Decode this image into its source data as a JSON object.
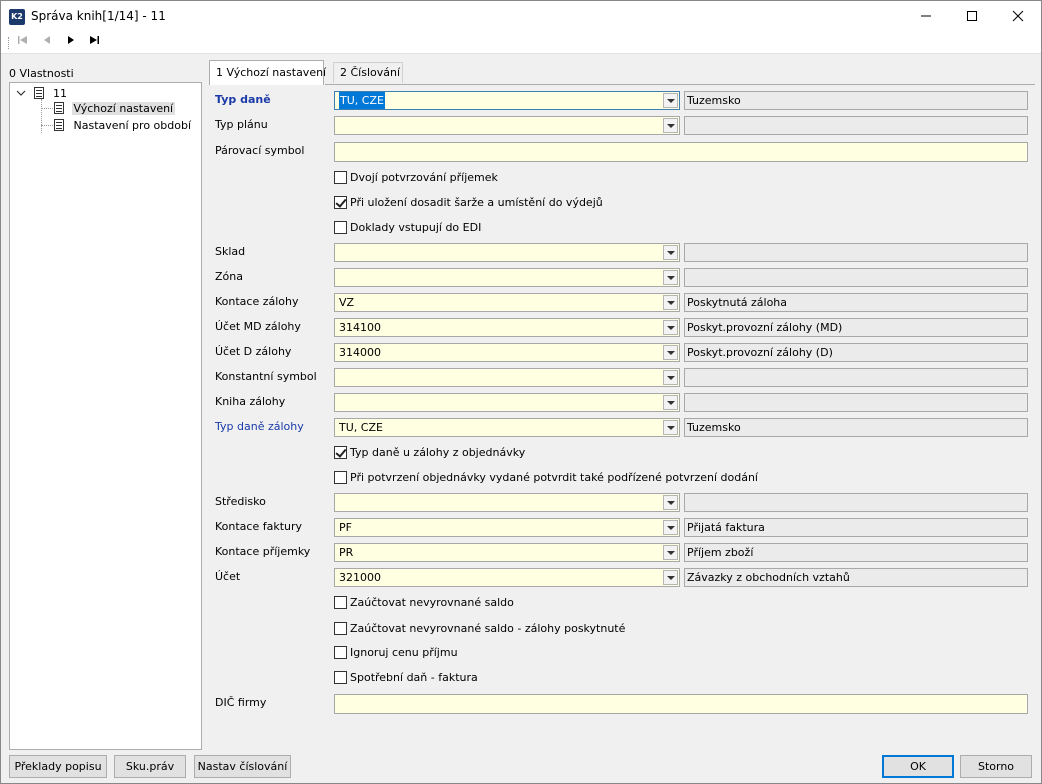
{
  "window": {
    "title": "Správa knih[1/14] - 11",
    "app_icon_text": "K2",
    "controls": [
      "minimize",
      "maximize",
      "close"
    ]
  },
  "toolbar": {
    "buttons": [
      {
        "name": "first-record",
        "enabled": false
      },
      {
        "name": "previous-record",
        "enabled": false
      },
      {
        "name": "next-record",
        "enabled": true
      },
      {
        "name": "last-record",
        "enabled": true
      }
    ]
  },
  "left_panel": {
    "title": "0 Vlastnosti",
    "tree": {
      "root": "11",
      "children": [
        "Výchozí nastavení",
        "Nastavení pro období"
      ],
      "selected": "Výchozí nastavení"
    }
  },
  "tabs": [
    {
      "label": "1 Výchozí nastavení",
      "active": true
    },
    {
      "label": "2 Číslování",
      "active": false
    }
  ],
  "form": {
    "typ_dane": {
      "label": "Typ daně",
      "value": "TU, CZE",
      "description": "Tuzemsko"
    },
    "typ_planu": {
      "label": "Typ plánu",
      "value": "",
      "description": ""
    },
    "parovaci_symbol": {
      "label": "Párovací symbol",
      "value": ""
    },
    "dvoji_potvrzovani": {
      "label": "Dvojí potvrzování příjemek",
      "checked": false
    },
    "pri_ulozeni": {
      "label": "Při uložení dosadit šarže a umístění do výdejů",
      "checked": true
    },
    "doklady_edi": {
      "label": "Doklady vstupují do EDI",
      "checked": false
    },
    "sklad": {
      "label": "Sklad",
      "value": "",
      "description": ""
    },
    "zona": {
      "label": "Zóna",
      "value": "",
      "description": ""
    },
    "kontace_zalohy": {
      "label": "Kontace zálohy",
      "value": "VZ",
      "description": "Poskytnutá záloha"
    },
    "ucet_md_zalohy": {
      "label": "Účet MD zálohy",
      "value": "314100",
      "description": "Poskyt.provozní zálohy (MD)"
    },
    "ucet_d_zalohy": {
      "label": "Účet D zálohy",
      "value": "314000",
      "description": "Poskyt.provozní zálohy (D)"
    },
    "konstantni_symbol": {
      "label": "Konstantní symbol",
      "value": "",
      "description": ""
    },
    "kniha_zalohy": {
      "label": "Kniha zálohy",
      "value": "",
      "description": ""
    },
    "typ_dane_zalohy": {
      "label": "Typ daně zálohy",
      "value": "TU, CZE",
      "description": "Tuzemsko"
    },
    "typ_dane_u_zalohy": {
      "label": "Typ daně u zálohy z objednávky",
      "checked": true
    },
    "pri_potvrzeni": {
      "label": "Při potvrzení objednávky vydané potvrdit také podřízené potvrzení dodání",
      "checked": false
    },
    "stredisko": {
      "label": "Středisko",
      "value": "",
      "description": ""
    },
    "kontace_faktury": {
      "label": "Kontace faktury",
      "value": "PF",
      "description": "Přijatá faktura"
    },
    "kontace_prijemky": {
      "label": "Kontace příjemky",
      "value": "PR",
      "description": "Příjem zboží"
    },
    "ucet": {
      "label": "Účet",
      "value": "321000",
      "description": "Závazky z obchodních vztahů"
    },
    "zauctovat_saldo": {
      "label": "Zaúčtovat nevyrovnané saldo",
      "checked": false
    },
    "zauctovat_saldo_zalohy": {
      "label": "Zaúčtovat nevyrovnané saldo - zálohy poskytnuté",
      "checked": false
    },
    "ignoruj_cenu": {
      "label": "Ignoruj cenu příjmu",
      "checked": false
    },
    "spotrebni_dan": {
      "label": "Spotřební daň - faktura",
      "checked": false
    },
    "dic_firmy": {
      "label": "DIČ firmy",
      "value": ""
    }
  },
  "bottom_buttons": {
    "preklady": "Překlady popisu",
    "sku_prav": "Sku.práv",
    "nastav_cislovani": "Nastav číslování",
    "ok": "OK",
    "storno": "Storno"
  },
  "colors": {
    "required_label": "#1a3aa8",
    "input_background": "#ffffe1",
    "readonly_background": "#ebebeb",
    "selection": "#0078d7"
  }
}
